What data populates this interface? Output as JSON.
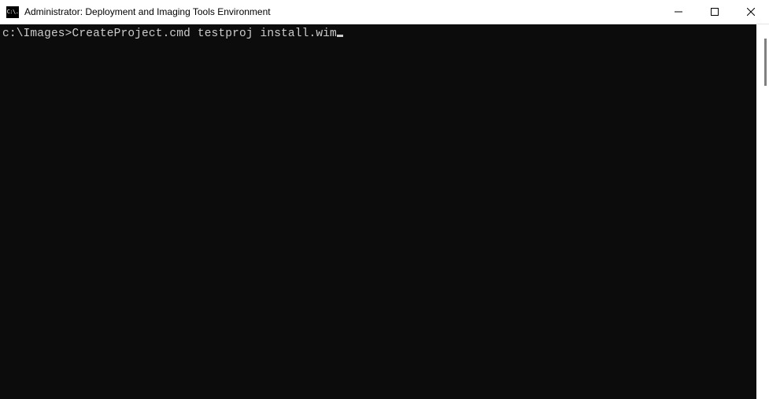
{
  "window": {
    "title": "Administrator: Deployment and Imaging Tools Environment",
    "icon_text": "C:\\."
  },
  "terminal": {
    "prompt": "c:\\Images>",
    "command": "CreateProject.cmd testproj install.wim"
  }
}
